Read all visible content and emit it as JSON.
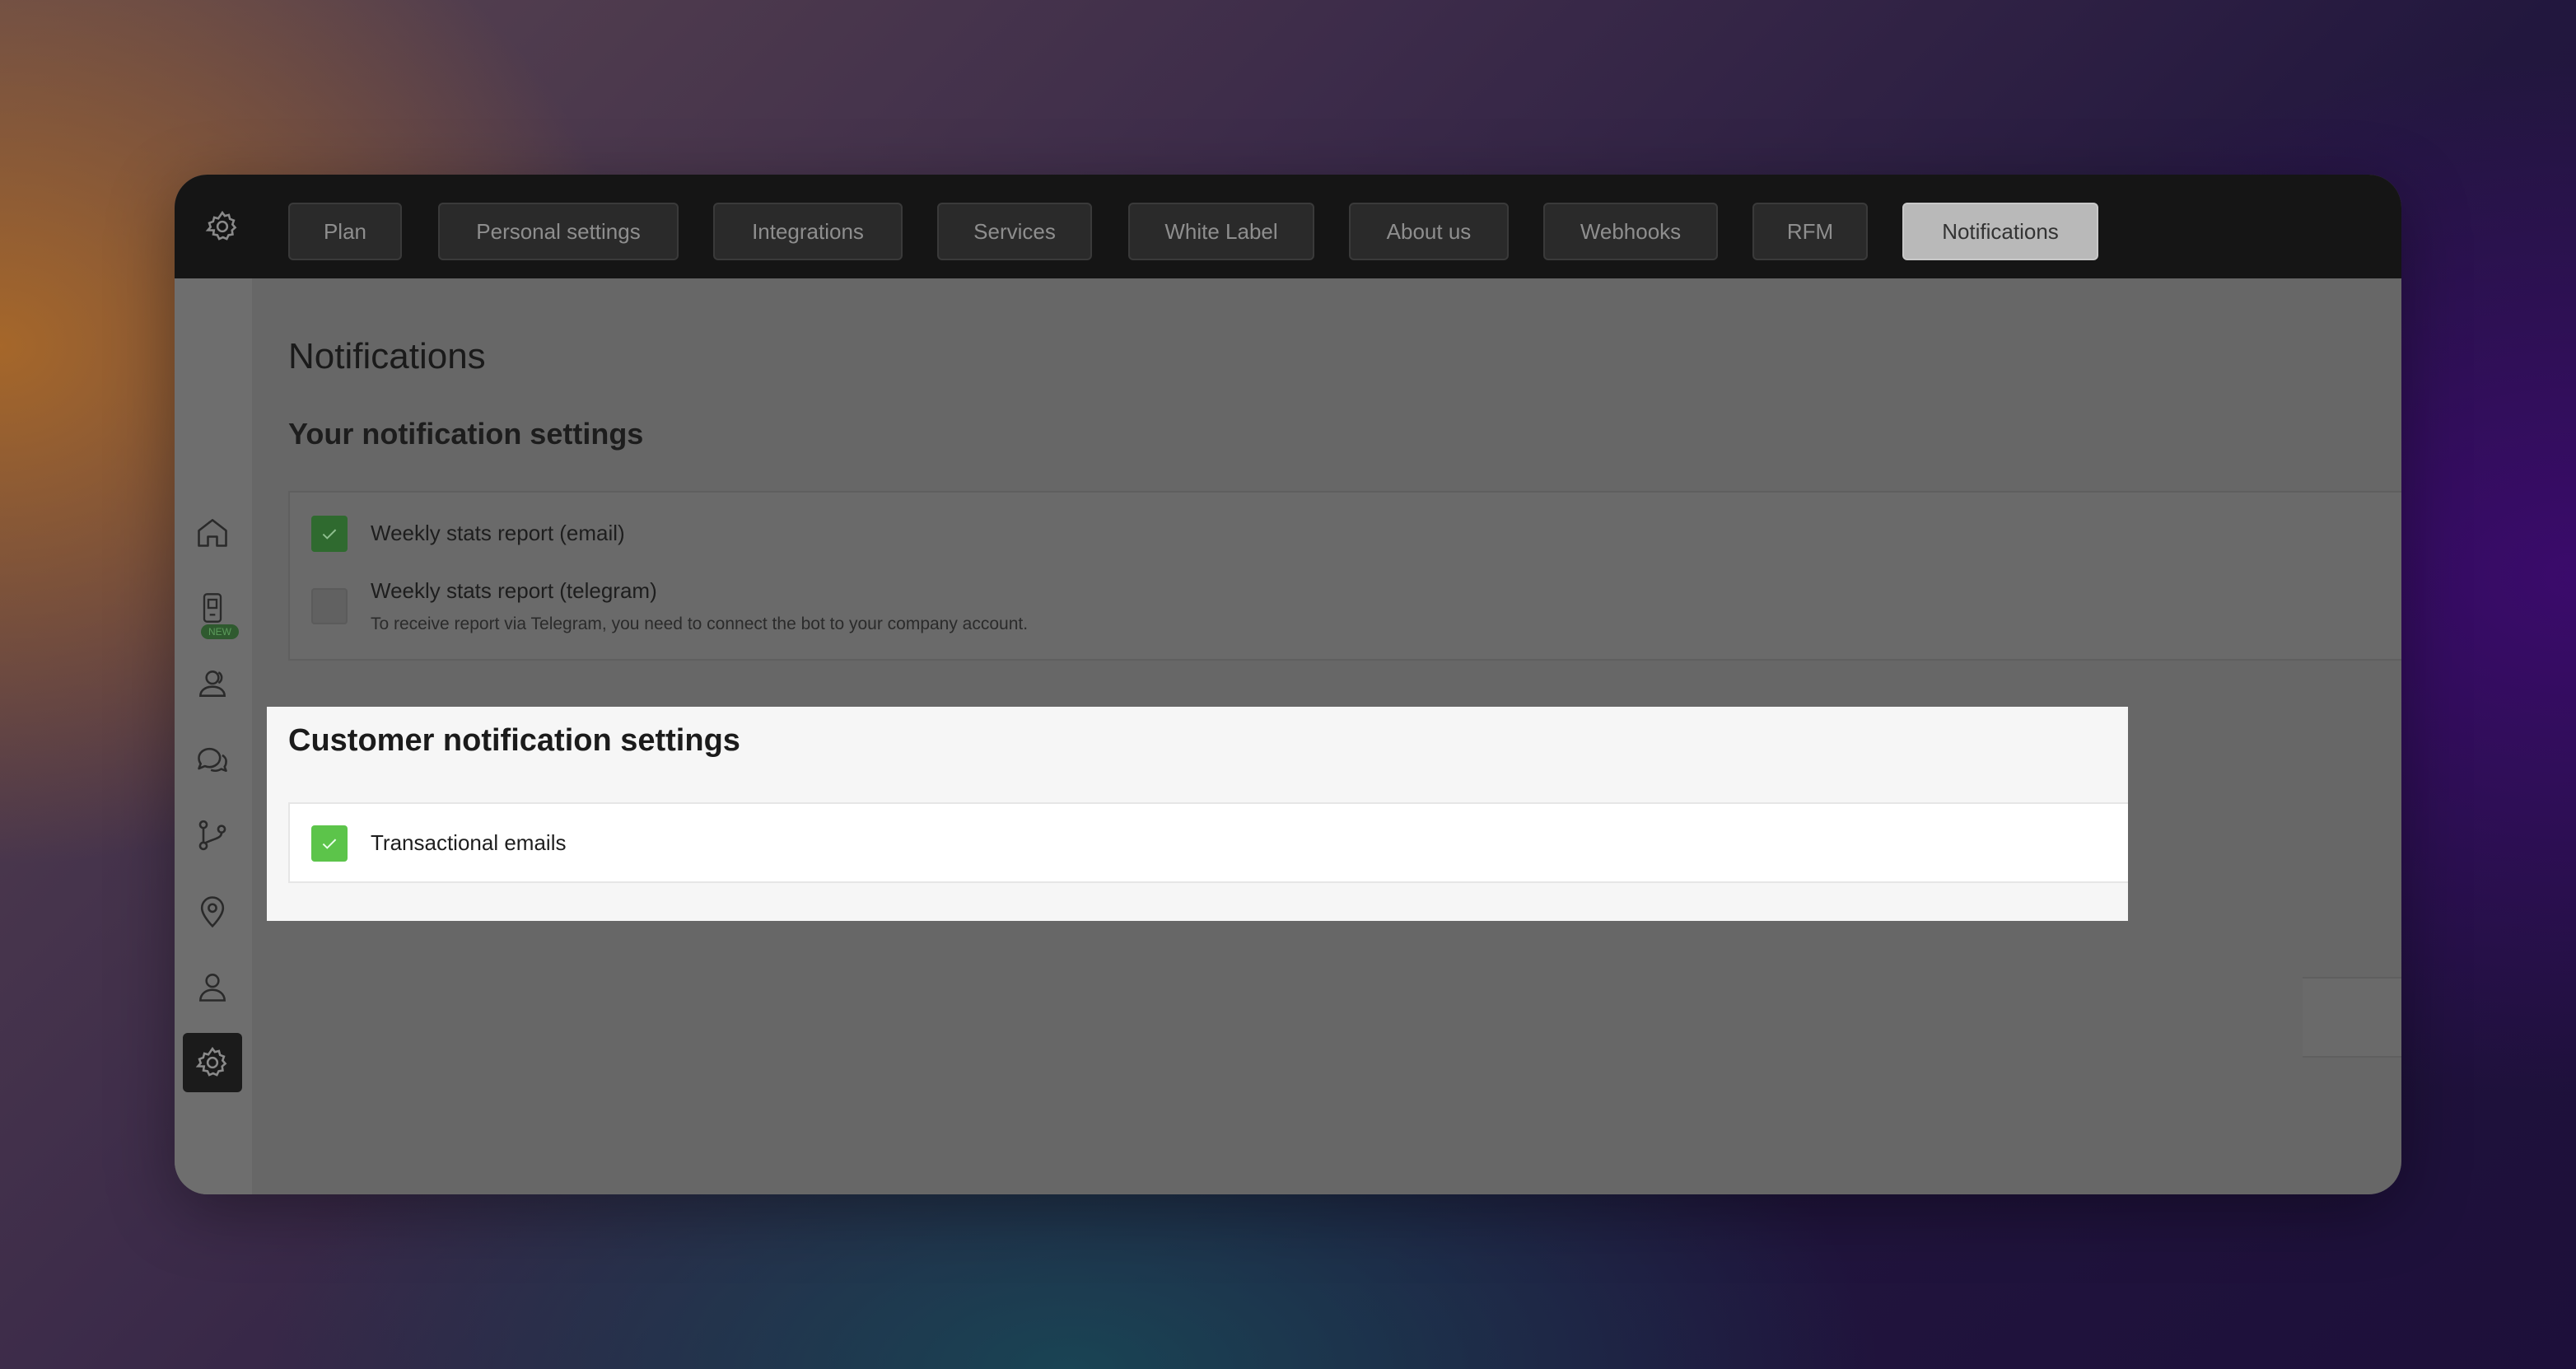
{
  "topbar": {
    "logo_icon": "gear-icon",
    "tabs": [
      {
        "label": "Plan"
      },
      {
        "label": "Personal settings"
      },
      {
        "label": "Integrations"
      },
      {
        "label": "Services"
      },
      {
        "label": "White Label"
      },
      {
        "label": "About us"
      },
      {
        "label": "Webhooks"
      },
      {
        "label": "RFM"
      },
      {
        "label": "Notifications",
        "active": true
      }
    ]
  },
  "sidebar": {
    "items": [
      {
        "icon": "home-icon"
      },
      {
        "icon": "mobile-app-icon",
        "badge": "NEW"
      },
      {
        "icon": "customers-icon"
      },
      {
        "icon": "chat-icon"
      },
      {
        "icon": "branch-icon"
      },
      {
        "icon": "location-pin-icon"
      },
      {
        "icon": "user-icon"
      },
      {
        "icon": "gear-icon",
        "active": true
      }
    ]
  },
  "main": {
    "title": "Notifications",
    "your_settings": {
      "title": "Your notification settings",
      "options": [
        {
          "label": "Weekly stats report (email)",
          "checked": true
        },
        {
          "label": "Weekly stats report (telegram)",
          "checked": false,
          "note": "To receive report via Telegram, you need to connect the bot to your company account."
        }
      ]
    },
    "customer_settings": {
      "title": "Customer notification settings",
      "options": [
        {
          "label": "Transactional emails",
          "checked": true
        }
      ]
    }
  },
  "colors": {
    "checkbox_checked": "#5cc44a",
    "topbar_bg": "#151515",
    "overlay_bg": "#676767",
    "highlight_bg": "#f6f6f6"
  }
}
